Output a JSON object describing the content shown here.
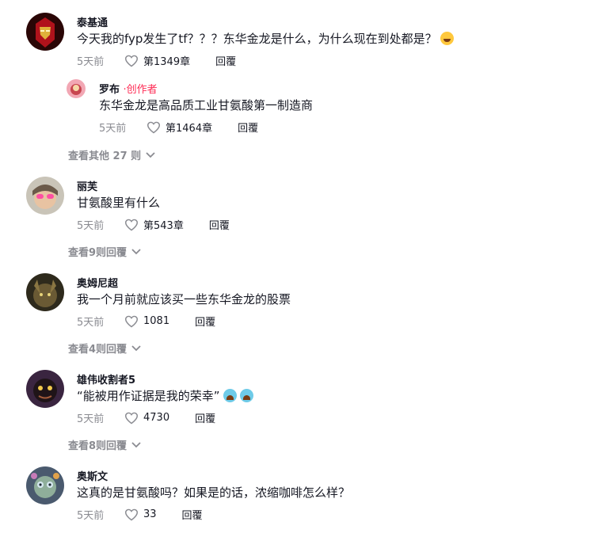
{
  "comments": [
    {
      "username": "泰基通",
      "text": "今天我的fyp发生了tf？？？东华金龙是什么，为什么现在到处都是？",
      "time": "5天前",
      "likes": "第1349章",
      "reply_label": "回覆",
      "emoji": "grinning-sweat-emoji",
      "reply": {
        "username": "罗布",
        "creator_tag": "·创作者",
        "text": "东华金龙是高品质工业甘氨酸第一制造商",
        "time": "5天前",
        "likes": "第1464章",
        "reply_label": "回覆"
      },
      "view_more": "查看其他 27 则"
    },
    {
      "username": "丽芙",
      "text": "甘氨酸里有什么",
      "time": "5天前",
      "likes": "第543章",
      "reply_label": "回覆",
      "view_more": "查看9则回覆"
    },
    {
      "username": "奥姆尼超",
      "text": "我一个月前就应该买一些东华金龙的股票",
      "time": "5天前",
      "likes": "1081",
      "reply_label": "回覆",
      "view_more": "查看4则回覆"
    },
    {
      "username": "雄伟收割者5",
      "text": "“能被用作证据是我的荣幸”",
      "time": "5天前",
      "likes": "4730",
      "reply_label": "回覆",
      "emoji": "crying-emoji",
      "view_more": "查看8则回覆"
    },
    {
      "username": "奥斯文",
      "text": "这真的是甘氨酸吗？如果是的话，浓缩咖啡怎么样？",
      "time": "5天前",
      "likes": "33",
      "reply_label": "回覆"
    }
  ]
}
